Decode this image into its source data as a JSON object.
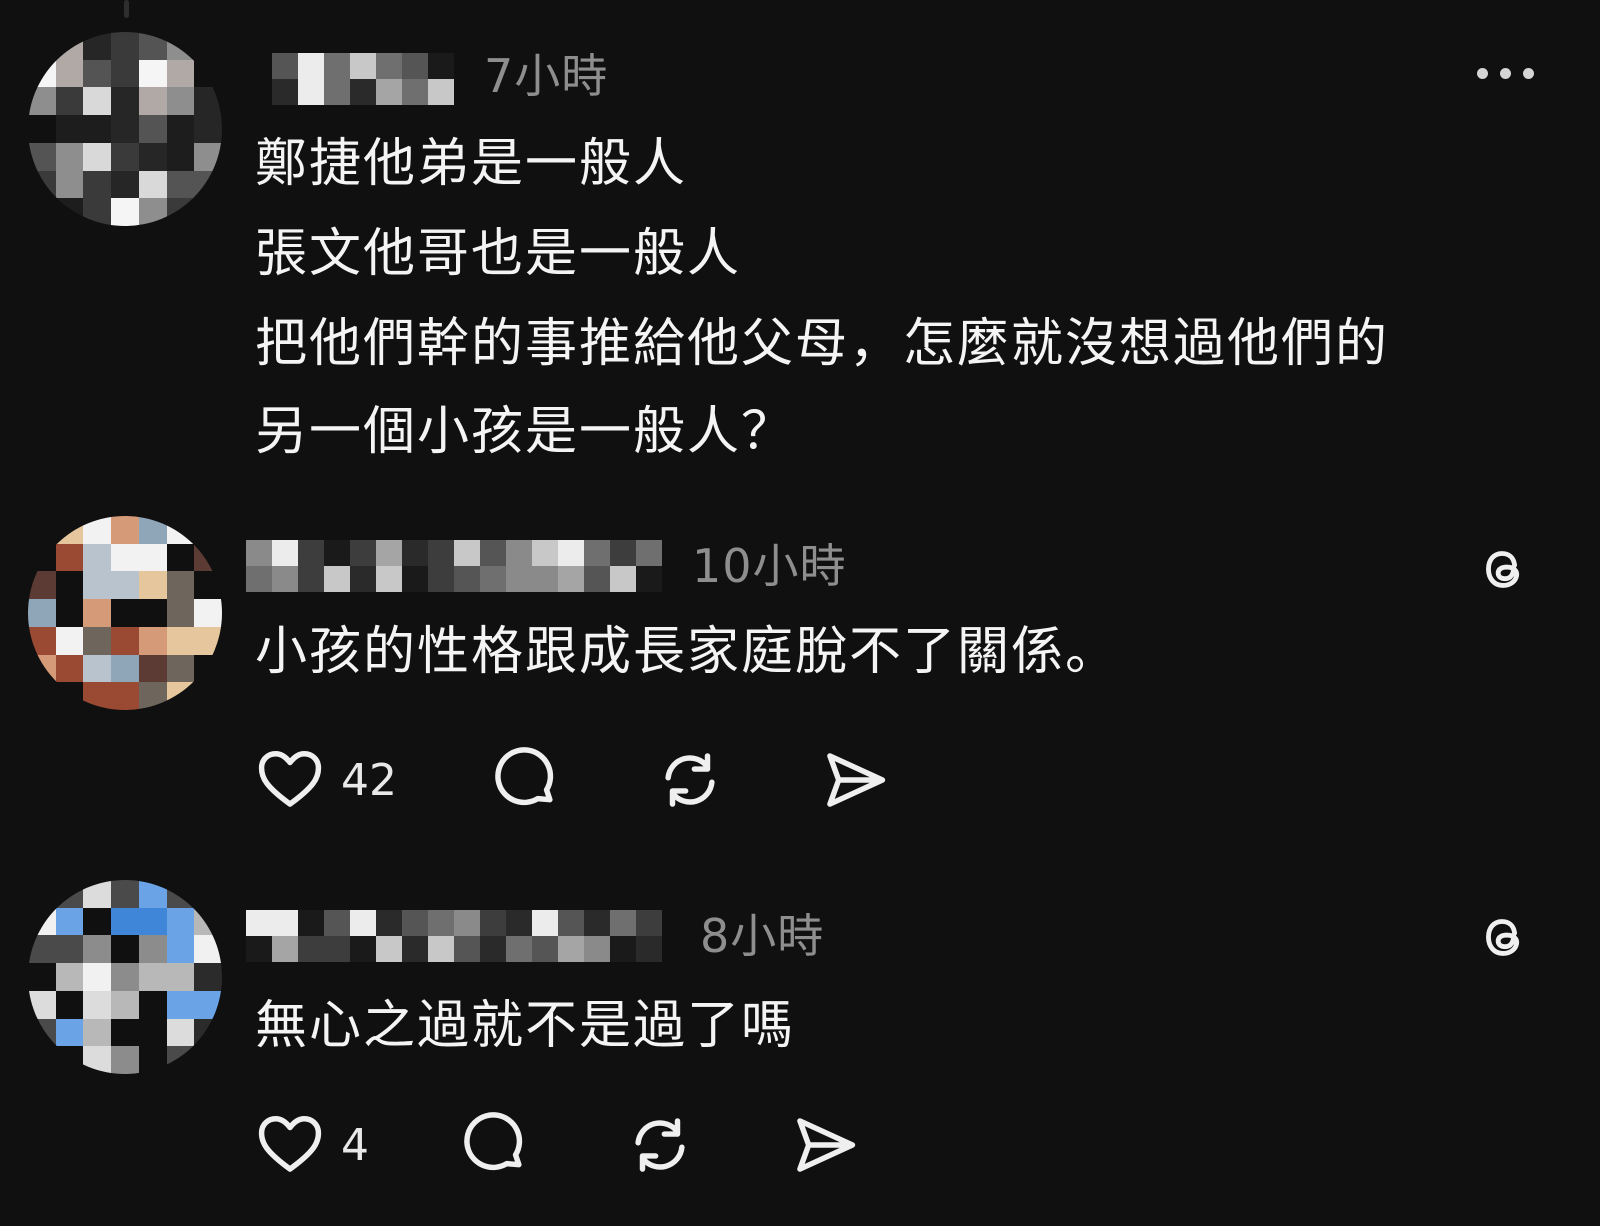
{
  "theme": {
    "background": "#101010",
    "text": "#f4f4f4",
    "muted": "#8e8e8e"
  },
  "posts": [
    {
      "time": "7小時",
      "lines": [
        "鄭捷他弟是一般人",
        "張文他哥也是一般人",
        "把他們幹的事推給他父母，怎麼就沒想過他們的",
        "另一個小孩是一般人？"
      ],
      "menu_icon": "more-horizontal-icon"
    },
    {
      "time": "10小時",
      "lines": [
        "小孩的性格跟成長家庭脫不了關係。"
      ],
      "likes": "42",
      "badge_icon": "threads-logo-icon"
    },
    {
      "time": "8小時",
      "lines": [
        "無心之過就不是過了嗎"
      ],
      "likes": "4",
      "badge_icon": "threads-logo-icon"
    }
  ],
  "action_icons": [
    "heart-icon",
    "comment-icon",
    "repost-icon",
    "share-icon"
  ]
}
